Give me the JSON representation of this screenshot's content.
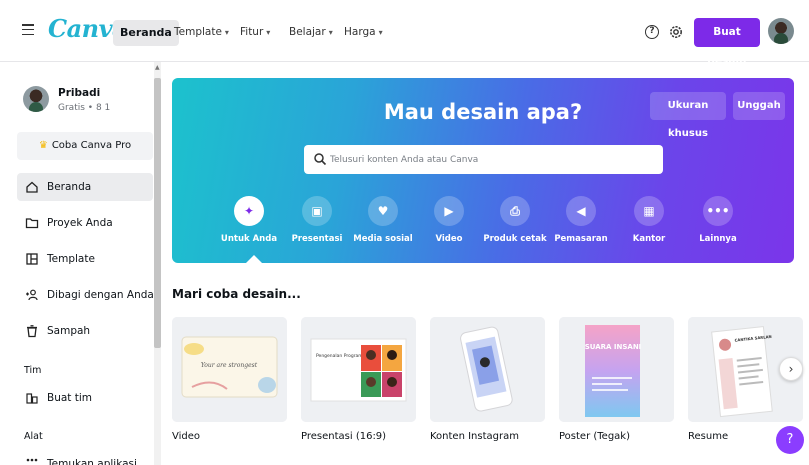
{
  "header": {
    "logo": "Canva",
    "home_label": "Beranda",
    "nav": [
      {
        "label": "Template"
      },
      {
        "label": "Fitur"
      },
      {
        "label": "Belajar"
      },
      {
        "label": "Harga"
      }
    ],
    "help_icon_glyph": "?",
    "create_label": "Buat desain"
  },
  "sidebar": {
    "profile": {
      "name": "Pribadi",
      "sub": "Gratis • 8 1"
    },
    "pro_label": "Coba Canva Pro",
    "items": [
      {
        "label": "Beranda"
      },
      {
        "label": "Proyek Anda"
      },
      {
        "label": "Template"
      },
      {
        "label": "Dibagi dengan Anda"
      },
      {
        "label": "Sampah"
      }
    ],
    "team_section": "Tim",
    "team_items": [
      {
        "label": "Buat tim"
      }
    ],
    "tools_section": "Alat",
    "tools_items": [
      {
        "label": "Temukan aplikasi"
      }
    ]
  },
  "hero": {
    "title": "Mau desain apa?",
    "custom_size_label": "Ukuran khusus",
    "upload_label": "Unggah",
    "search_placeholder": "Telusuri konten Anda atau Canva",
    "categories": [
      {
        "label": "Untuk Anda",
        "glyph": "✦"
      },
      {
        "label": "Presentasi",
        "glyph": "▣"
      },
      {
        "label": "Media sosial",
        "glyph": "♥"
      },
      {
        "label": "Video",
        "glyph": "▶"
      },
      {
        "label": "Produk cetak",
        "glyph": "⎙"
      },
      {
        "label": "Pemasaran",
        "glyph": "◀"
      },
      {
        "label": "Kantor",
        "glyph": "▦"
      },
      {
        "label": "Lainnya",
        "glyph": "•••"
      }
    ]
  },
  "try_section": {
    "title": "Mari coba desain...",
    "cards": [
      {
        "label": "Video",
        "art_text": "Your are strongest"
      },
      {
        "label": "Presentasi (16:9)",
        "art_text": "Pengenalan Program Baru"
      },
      {
        "label": "Konten Instagram",
        "art_text": ""
      },
      {
        "label": "Poster (Tegak)",
        "art_text": "SUARA INSANI"
      },
      {
        "label": "Resume",
        "art_text": "CANTIKA SARLAN"
      }
    ]
  },
  "help_fab_glyph": "?",
  "colors": {
    "accent": "#7d2ae8",
    "logo": "#24b3d1"
  }
}
